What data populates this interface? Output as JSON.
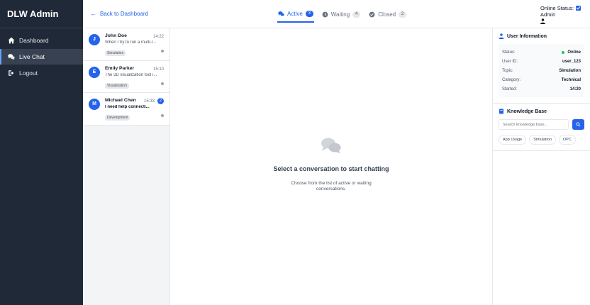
{
  "app": {
    "title": "DLW Admin"
  },
  "sidebar": {
    "items": [
      {
        "label": "Dashboard",
        "icon": "home-icon"
      },
      {
        "label": "Live Chat",
        "icon": "chat-icon",
        "active": true
      },
      {
        "label": "Logout",
        "icon": "logout-icon"
      }
    ]
  },
  "header": {
    "back_label": "Back to Dashboard",
    "tabs": [
      {
        "label": "Active",
        "count": "3",
        "icon": "chat-icon",
        "active": true
      },
      {
        "label": "Waiting",
        "count": "4",
        "icon": "clock-icon"
      },
      {
        "label": "Closed",
        "count": "2",
        "icon": "check-circle-icon"
      }
    ],
    "online_status_label": "Online Status:",
    "role": "Admin"
  },
  "conversations": [
    {
      "initial": "J",
      "name": "John Doe",
      "time": "14:22",
      "preview": "When I try to run a multi-l...",
      "tag": "Simulation",
      "unread": ""
    },
    {
      "initial": "E",
      "name": "Emily Parker",
      "time": "15:10",
      "preview": "The 3D visualization tool i...",
      "tag": "Visualization",
      "unread": ""
    },
    {
      "initial": "M",
      "name": "Michael Chen",
      "time": "15:33",
      "preview": "I need help connecti...",
      "tag": "Development",
      "unread": "2"
    }
  ],
  "chat": {
    "empty_title": "Select a conversation to start chatting",
    "empty_subtitle": "Choose from the list of active or waiting conversations."
  },
  "user_info": {
    "title": "User Information",
    "rows": [
      {
        "key": "Status:",
        "value": "Online"
      },
      {
        "key": "User ID:",
        "value": "user_123"
      },
      {
        "key": "Topic:",
        "value": "Simulation"
      },
      {
        "key": "Category:",
        "value": "Technical"
      },
      {
        "key": "Started:",
        "value": "14:20"
      }
    ]
  },
  "knowledge_base": {
    "title": "Knowledge Base",
    "search_placeholder": "Search knowledge base...",
    "tags": [
      "App Usage",
      "Simulation",
      "OPC"
    ]
  },
  "colors": {
    "accent": "#2563eb",
    "sidebar_bg": "#1f2937",
    "online": "#22c55e"
  }
}
